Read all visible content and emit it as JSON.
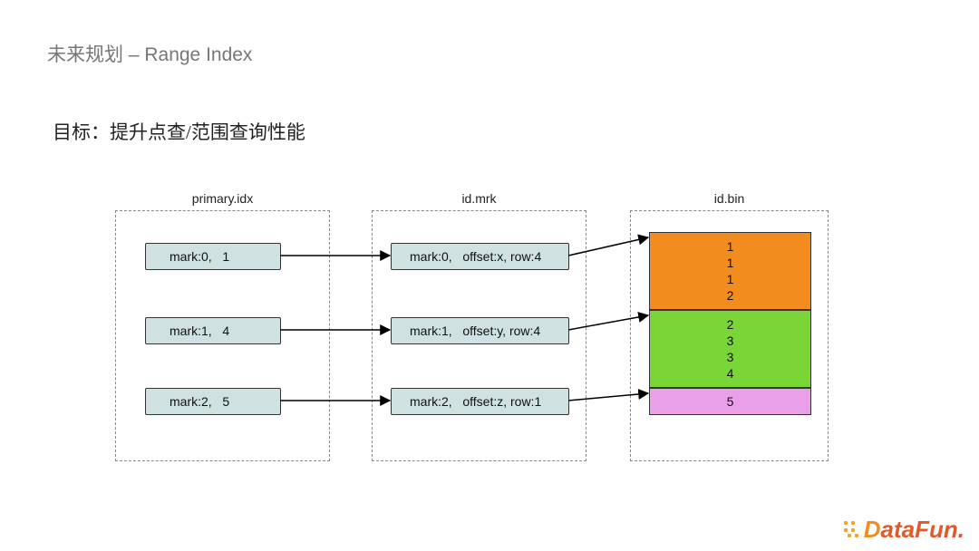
{
  "title": "未来规划 – Range Index",
  "subtitle": "目标：提升点查/范围查询性能",
  "columns": {
    "primary": {
      "label": "primary.idx",
      "rows": [
        "mark:0,   1",
        "mark:1,   4",
        "mark:2,   5"
      ]
    },
    "mrk": {
      "label": "id.mrk",
      "rows": [
        "mark:0,   offset:x, row:4",
        "mark:1,   offset:y, row:4",
        "mark:2,   offset:z, row:1"
      ]
    },
    "bin": {
      "label": "id.bin",
      "blocks": [
        {
          "color": "#f28c1f",
          "values": [
            "1",
            "1",
            "1",
            "2"
          ]
        },
        {
          "color": "#79d636",
          "values": [
            "2",
            "3",
            "3",
            "4"
          ]
        },
        {
          "color": "#e9a0e9",
          "values": [
            "5"
          ]
        }
      ]
    }
  },
  "logo": {
    "text": "DataFun."
  }
}
